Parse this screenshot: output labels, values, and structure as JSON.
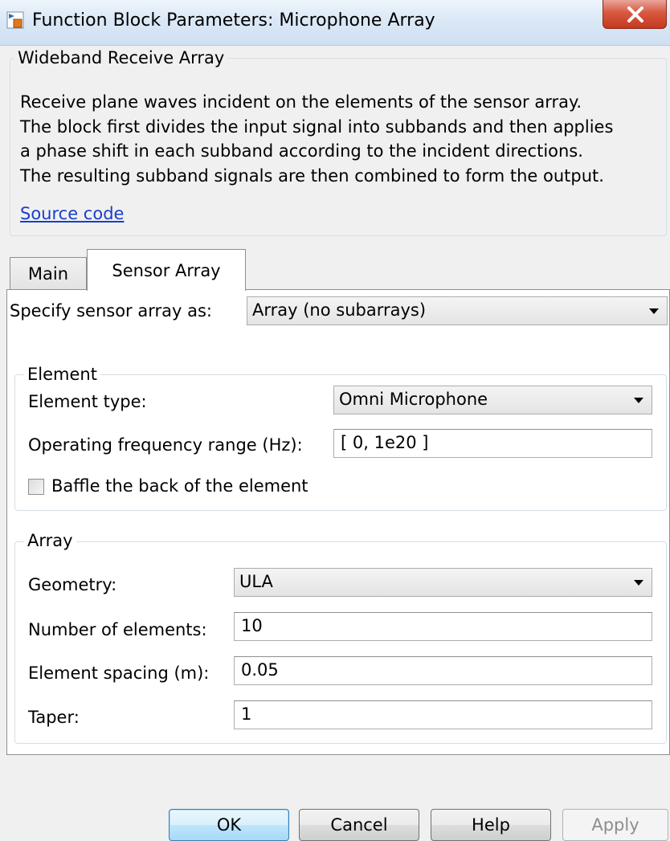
{
  "window": {
    "title": "Function Block Parameters: Microphone Array",
    "close_glyph": "X"
  },
  "description": {
    "group_title": "Wideband Receive Array",
    "text": "Receive plane waves incident on the elements of the sensor array.\nThe block first divides the input signal into subbands and then applies\na phase shift in each subband according to the incident directions.\nThe resulting subband signals are then combined to form the output.",
    "link": "Source code"
  },
  "tabs": [
    {
      "label": "Main",
      "selected": false
    },
    {
      "label": "Sensor Array",
      "selected": true
    }
  ],
  "sensor_array": {
    "specify_label": "Specify sensor array as:",
    "specify_value": "Array (no subarrays)",
    "element": {
      "group_title": "Element",
      "type_label": "Element type:",
      "type_value": "Omni Microphone",
      "freq_label": "Operating frequency range (Hz):",
      "freq_value": "[ 0, 1e20 ]",
      "baffle_label": "Baffle the back of the element",
      "baffle_checked": false
    },
    "array": {
      "group_title": "Array",
      "geometry_label": "Geometry:",
      "geometry_value": "ULA",
      "num_label": "Number of elements:",
      "num_value": "10",
      "spacing_label": "Element spacing (m):",
      "spacing_value": "0.05",
      "taper_label": "Taper:",
      "taper_value": "1"
    }
  },
  "buttons": {
    "ok": "OK",
    "cancel": "Cancel",
    "help": "Help",
    "apply": "Apply"
  },
  "icons": {
    "app": "simulink-block-icon",
    "close": "close-icon",
    "dropdown": "chevron-down-icon"
  }
}
